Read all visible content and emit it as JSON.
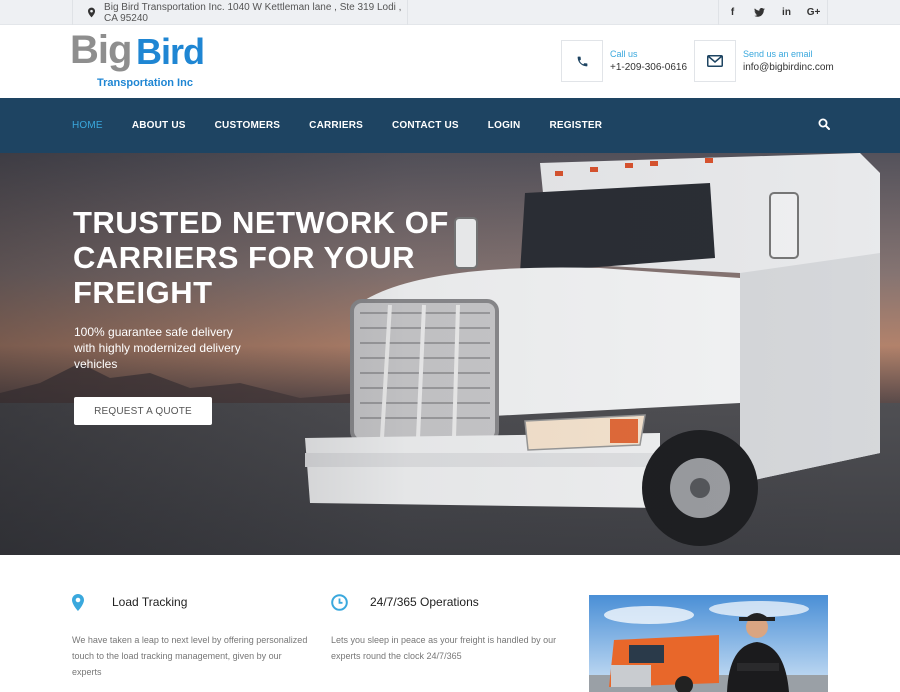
{
  "topbar": {
    "address": "Big Bird Transportation Inc. 1040 W Kettleman lane , Ste 319 Lodi , CA 95240",
    "social": [
      {
        "icon": "facebook-icon",
        "label": "f"
      },
      {
        "icon": "twitter-icon",
        "label": "t"
      },
      {
        "icon": "linkedin-icon",
        "label": "in"
      },
      {
        "icon": "google-plus-icon",
        "label": "G+"
      }
    ]
  },
  "logo": {
    "word1": "Big",
    "word2": "Bird",
    "subtitle": "Transportation Inc"
  },
  "contact": {
    "phone_label": "Call us",
    "phone_value": "+1-209-306-0616",
    "email_label": "Send us an email",
    "email_value": "info@bigbirdinc.com"
  },
  "nav": {
    "items": [
      {
        "label": "HOME",
        "active": true
      },
      {
        "label": "ABOUT US",
        "active": false
      },
      {
        "label": "CUSTOMERS",
        "active": false
      },
      {
        "label": "CARRIERS",
        "active": false
      },
      {
        "label": "CONTACT US",
        "active": false
      },
      {
        "label": "LOGIN",
        "active": false
      },
      {
        "label": "REGISTER",
        "active": false
      }
    ]
  },
  "hero": {
    "title": "TRUSTED NETWORK OF CARRIERS FOR YOUR FREIGHT",
    "subtitle": "100% guarantee safe delivery with highly modernized delivery vehicles",
    "cta": "REQUEST A QUOTE"
  },
  "features": [
    {
      "icon": "map-pin-icon",
      "title": "Load Tracking",
      "text": "We have taken a leap to next level by offering personalized touch to the load tracking management, given by our experts"
    },
    {
      "icon": "clock-icon",
      "title": "24/7/365 Operations",
      "text": "Lets you sleep in peace as your freight is handled by our experts round the clock 24/7/365"
    }
  ],
  "colors": {
    "accent": "#3aa8dd",
    "nav_bg": "#1e4462",
    "brand_blue": "#1f86d3"
  }
}
